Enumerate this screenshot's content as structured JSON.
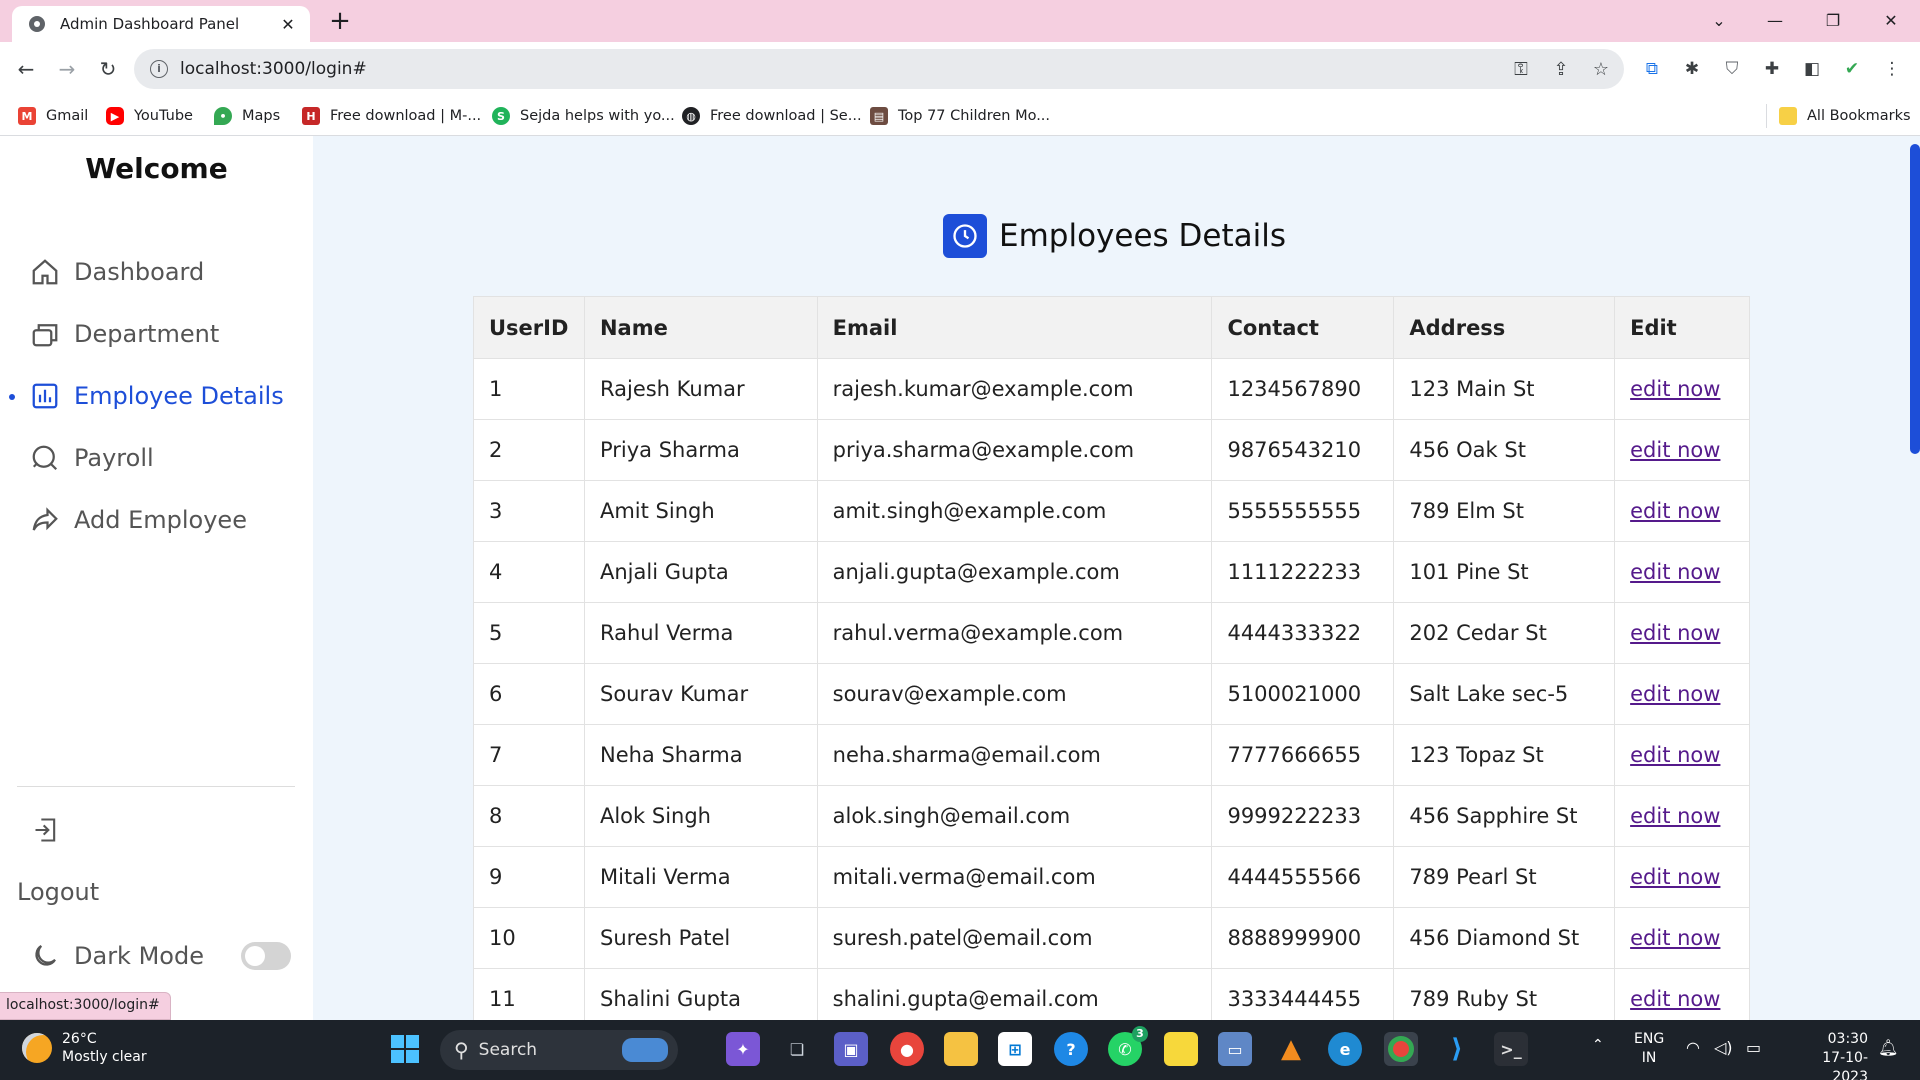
{
  "browser": {
    "tab_title": "Admin Dashboard Panel",
    "url": "localhost:3000/login#",
    "status_url": "localhost:3000/login#",
    "bookmarks": [
      {
        "label": "Gmail",
        "icon": "gmail-icon",
        "color": "#ea4335"
      },
      {
        "label": "YouTube",
        "icon": "youtube-icon",
        "color": "#ff0000"
      },
      {
        "label": "Maps",
        "icon": "maps-icon",
        "color": "#34a853"
      },
      {
        "label": "Free download | M-...",
        "icon": "download-site-icon",
        "color": "#c62828"
      },
      {
        "label": "Sejda helps with yo...",
        "icon": "sejda-icon",
        "color": "#20b35a"
      },
      {
        "label": "Free download | Se...",
        "icon": "globe-icon",
        "color": "#202124"
      },
      {
        "label": "Top 77 Children Mo...",
        "icon": "site-icon",
        "color": "#6d4c41"
      }
    ],
    "all_bookmarks": "All Bookmarks"
  },
  "sidebar": {
    "welcome": "Welcome",
    "items": [
      {
        "label": "Dashboard",
        "icon": "home-icon"
      },
      {
        "label": "Department",
        "icon": "files-icon"
      },
      {
        "label": "Employee Details",
        "icon": "chart-icon"
      },
      {
        "label": "Payroll",
        "icon": "search-chat-icon"
      },
      {
        "label": "Add Employee",
        "icon": "share-icon"
      }
    ],
    "logout": "Logout",
    "dark_mode": "Dark Mode",
    "dark_mode_on": false
  },
  "main": {
    "title": "Employees Details",
    "columns": [
      "UserID",
      "Name",
      "Email",
      "Contact",
      "Address",
      "Edit"
    ],
    "rows": [
      [
        "1",
        "Rajesh Kumar",
        "rajesh.kumar@example.com",
        "1234567890",
        "123 Main St",
        "edit now"
      ],
      [
        "2",
        "Priya Sharma",
        "priya.sharma@example.com",
        "9876543210",
        "456 Oak St",
        "edit now"
      ],
      [
        "3",
        "Amit Singh",
        "amit.singh@example.com",
        "5555555555",
        "789 Elm St",
        "edit now"
      ],
      [
        "4",
        "Anjali Gupta",
        "anjali.gupta@example.com",
        "1111222233",
        "101 Pine St",
        "edit now"
      ],
      [
        "5",
        "Rahul Verma",
        "rahul.verma@example.com",
        "4444333322",
        "202 Cedar St",
        "edit now"
      ],
      [
        "6",
        "Sourav Kumar",
        "sourav@example.com",
        "5100021000",
        "Salt Lake sec-5",
        "edit now"
      ],
      [
        "7",
        "Neha Sharma",
        "neha.sharma@email.com",
        "7777666655",
        "123 Topaz St",
        "edit now"
      ],
      [
        "8",
        "Alok Singh",
        "alok.singh@email.com",
        "9999222233",
        "456 Sapphire St",
        "edit now"
      ],
      [
        "9",
        "Mitali Verma",
        "mitali.verma@email.com",
        "4444555566",
        "789 Pearl St",
        "edit now"
      ],
      [
        "10",
        "Suresh Patel",
        "suresh.patel@email.com",
        "8888999900",
        "456 Diamond St",
        "edit now"
      ],
      [
        "11",
        "Shalini Gupta",
        "shalini.gupta@email.com",
        "3333444455",
        "789 Ruby St",
        "edit now"
      ]
    ]
  },
  "taskbar": {
    "temperature": "26°C",
    "weather": "Mostly clear",
    "search": "Search",
    "whatsapp_badge": "3",
    "language": "ENG",
    "region": "IN",
    "time": "03:30",
    "date": "17-10-2023"
  },
  "colors": {
    "accent": "#1d4ed8",
    "tabstrip": "#f5cfe0",
    "main_bg": "#eef5fc",
    "link": "#551a8b"
  }
}
